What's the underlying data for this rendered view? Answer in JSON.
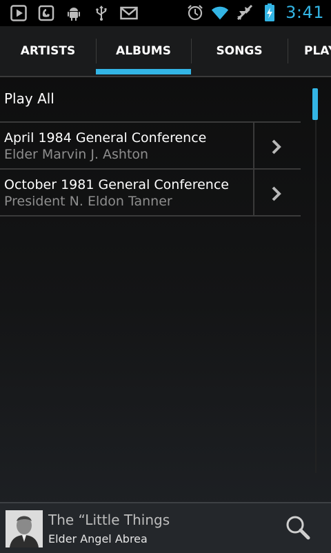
{
  "status_bar": {
    "time": "3:41",
    "left_icons": [
      "play-store-icon",
      "voicemail-icon",
      "android-debug-icon",
      "usb-icon",
      "gmail-icon"
    ],
    "right_icons": [
      "alarm-icon",
      "wifi-icon",
      "airplane-mode-icon",
      "battery-charging-icon"
    ],
    "accent_color": "#33b5e5"
  },
  "tabs": [
    {
      "label": "ARTISTS",
      "selected": false
    },
    {
      "label": "ALBUMS",
      "selected": true
    },
    {
      "label": "SONGS",
      "selected": false
    },
    {
      "label": "PLAY",
      "selected": false
    }
  ],
  "list": {
    "play_all": "Play All",
    "items": [
      {
        "title": "April 1984 General Conference",
        "subtitle": "Elder Marvin J. Ashton"
      },
      {
        "title": "October 1981 General Conference",
        "subtitle": "President N. Eldon Tanner"
      }
    ]
  },
  "now_playing": {
    "title": "The “Little Things",
    "artist": "Elder Angel Abrea",
    "search_icon": "search-icon"
  }
}
